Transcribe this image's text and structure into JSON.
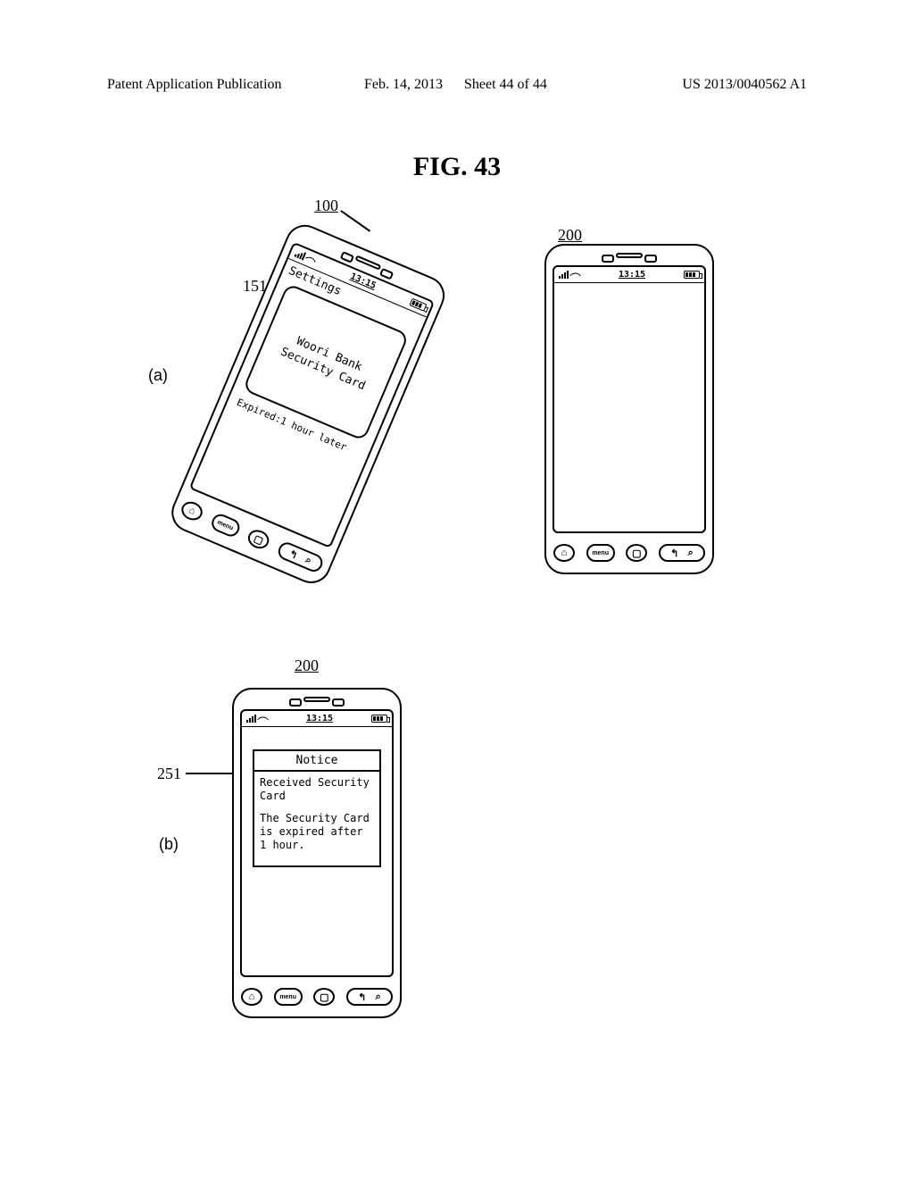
{
  "header": {
    "publication": "Patent Application Publication",
    "date": "Feb. 14, 2013",
    "sheet": "Sheet 44 of 44",
    "docnum": "US 2013/0040562 A1"
  },
  "figure_title": "FIG. 43",
  "panels": {
    "a": "(a)",
    "b": "(b)"
  },
  "refs": {
    "r100": "100",
    "r200": "200",
    "r151": "151",
    "r251": "251"
  },
  "status": {
    "time": "13:15"
  },
  "phoneA": {
    "screen_title": "Settings",
    "card_line1": "Woori Bank",
    "card_line2": "Security Card",
    "expired": "Expired:1 hour later"
  },
  "phoneC": {
    "notice_title": "Notice",
    "notice_p1": "Received Security Card",
    "notice_p2": "The Security Card is expired after 1 hour."
  },
  "hw": {
    "home": "⌂",
    "menu": "menu",
    "stop": "▢",
    "back": "↰",
    "search": "⌕"
  }
}
